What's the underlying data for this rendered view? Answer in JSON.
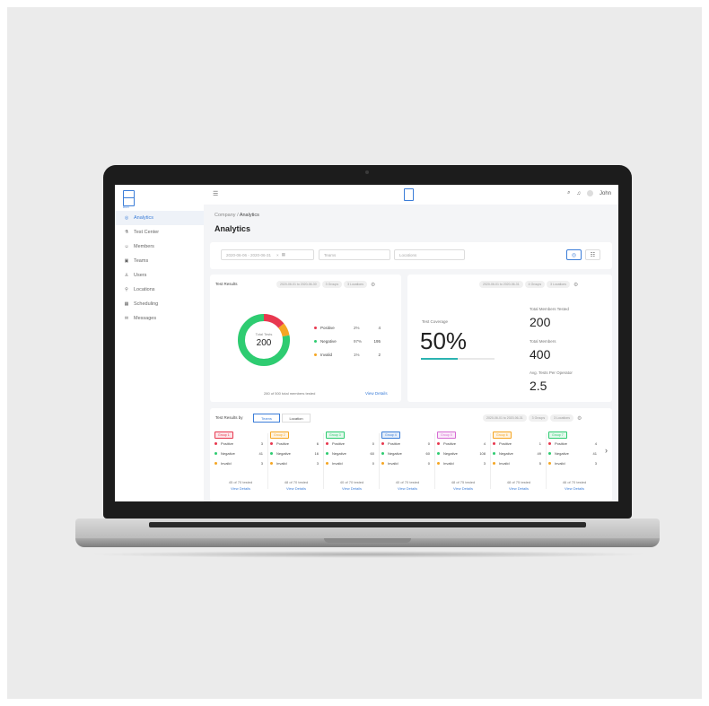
{
  "sidebar": {
    "logo_label": "DUO",
    "items": [
      {
        "label": "Analytics",
        "icon": "dashboard-icon",
        "active": true
      },
      {
        "label": "Test Center",
        "icon": "flask-icon"
      },
      {
        "label": "Members",
        "icon": "members-icon"
      },
      {
        "label": "Teams",
        "icon": "teams-icon"
      },
      {
        "label": "Users",
        "icon": "user-icon"
      },
      {
        "label": "Locations",
        "icon": "location-pin-icon"
      },
      {
        "label": "Scheduling",
        "icon": "calendar-icon"
      },
      {
        "label": "Messages",
        "icon": "message-icon"
      }
    ]
  },
  "topbar": {
    "user_name": "John",
    "center_logo_label": "DUO"
  },
  "breadcrumb": {
    "root": "Company",
    "sep": " / ",
    "current": "Analytics"
  },
  "page_title": "Analytics",
  "filters": {
    "date_range": "2020-06-06 - 2020-06-31",
    "clear_symbol": "×",
    "teams_placeholder": "Teams",
    "locations_placeholder": "Locations"
  },
  "test_results": {
    "title": "Test Results",
    "date_pill": "2020-06-01 to 2020-06-30",
    "groups_pill": "3 Groups",
    "locations_pill": "3 Locations",
    "donut_label": "Total Tests",
    "donut_value": "200",
    "donut_fractions": {
      "positive": 0.02,
      "negative": 0.97,
      "invalid": 0.01
    },
    "legend": [
      {
        "label": "Positive",
        "pct": "2%",
        "count": "4",
        "color": "#e8384f"
      },
      {
        "label": "Negative",
        "pct": "97%",
        "count": "195",
        "color": "#2ecc71"
      },
      {
        "label": "Invalid",
        "pct": "1%",
        "count": "2",
        "color": "#f5a623"
      }
    ],
    "footer_text": "280 of 500 total members tested",
    "view_details": "View Details"
  },
  "coverage": {
    "date_pill": "2020-06-01 to 2020-06-31",
    "groups_pill": "4 Groups",
    "locations_pill": "3 Locations",
    "label": "Test Coverage",
    "value": "50%",
    "fraction": 0.5,
    "stats": [
      {
        "label": "Total Members Tested",
        "value": "200"
      },
      {
        "label": "Total Members",
        "value": "400"
      },
      {
        "label": "Avg. Tests Per Operator",
        "value": "2.5"
      }
    ]
  },
  "by_team": {
    "title": "Test Results by",
    "seg_teams": "Teams",
    "seg_location": "Location",
    "date_pill": "2020-06-01 to 2020-06-31",
    "groups_pill": "3 Groups",
    "locations_pill": "3 Locations",
    "next_symbol": "›",
    "groups": [
      {
        "tag": "Group 1",
        "color": "#e8384f",
        "pos": "3",
        "neg": "41",
        "inv": "3",
        "tested": "45 of 70 tested"
      },
      {
        "tag": "Group 2",
        "color": "#f5a623",
        "pos": "6",
        "neg": "16",
        "inv": "3",
        "tested": "48 of 70 tested"
      },
      {
        "tag": "Group 3",
        "color": "#2ecc71",
        "pos": "0",
        "neg": "60",
        "inv": "0",
        "tested": "40 of 70 tested"
      },
      {
        "tag": "Group 4",
        "color": "#3b7dd8",
        "pos": "0",
        "neg": "60",
        "inv": "0",
        "tested": "40 of 70 tested"
      },
      {
        "tag": "Group 5",
        "color": "#d66bd3",
        "pos": "4",
        "neg": "108",
        "inv": "3",
        "tested": "48 of 75 tested"
      },
      {
        "tag": "Group 6",
        "color": "#f5a623",
        "pos": "1",
        "neg": "49",
        "inv": "5",
        "tested": "48 of 75 tested"
      },
      {
        "tag": "Group 7",
        "color": "#2ecc71",
        "pos": "4",
        "neg": "41",
        "inv": "3",
        "tested": "46 of 70 tested"
      }
    ],
    "labels": {
      "pos": "Positive",
      "neg": "Negative",
      "inv": "Invalid",
      "view": "View Details"
    }
  }
}
